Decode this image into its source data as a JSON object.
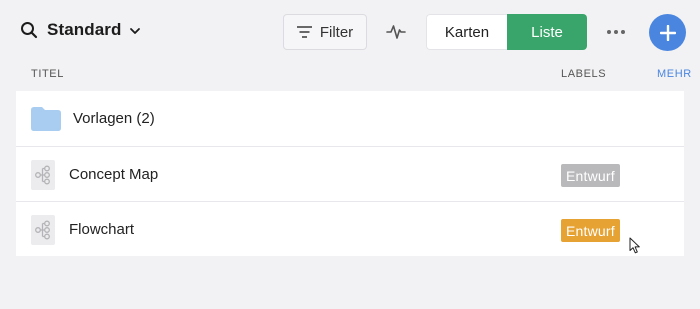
{
  "toolbar": {
    "view_title": "Standard",
    "filter_label": "Filter",
    "view_mode": {
      "karten_label": "Karten",
      "liste_label": "Liste",
      "active": "Liste"
    },
    "icons": {
      "search": "search-icon",
      "dropdown": "chevron-down-icon",
      "filter": "filter-lines-icon",
      "activity": "activity-pulse-icon",
      "more": "more-horizontal-icon",
      "add": "plus-icon"
    }
  },
  "columns": {
    "title": "TITEL",
    "labels": "LABELS",
    "more": "MEHR"
  },
  "rows": [
    {
      "title": "Vorlagen (2)",
      "icon": "folder-icon",
      "label": ""
    },
    {
      "title": "Concept Map",
      "icon": "mindmap-icon",
      "label": "Entwurf",
      "label_color": "#b9b9bc"
    },
    {
      "title": "Flowchart",
      "icon": "mindmap-icon",
      "label": "Entwurf",
      "label_color": "#e6a232"
    }
  ],
  "colors": {
    "accent_blue": "#4a86e0",
    "active_green": "#3aa56a",
    "background": "#f2f2f4"
  }
}
